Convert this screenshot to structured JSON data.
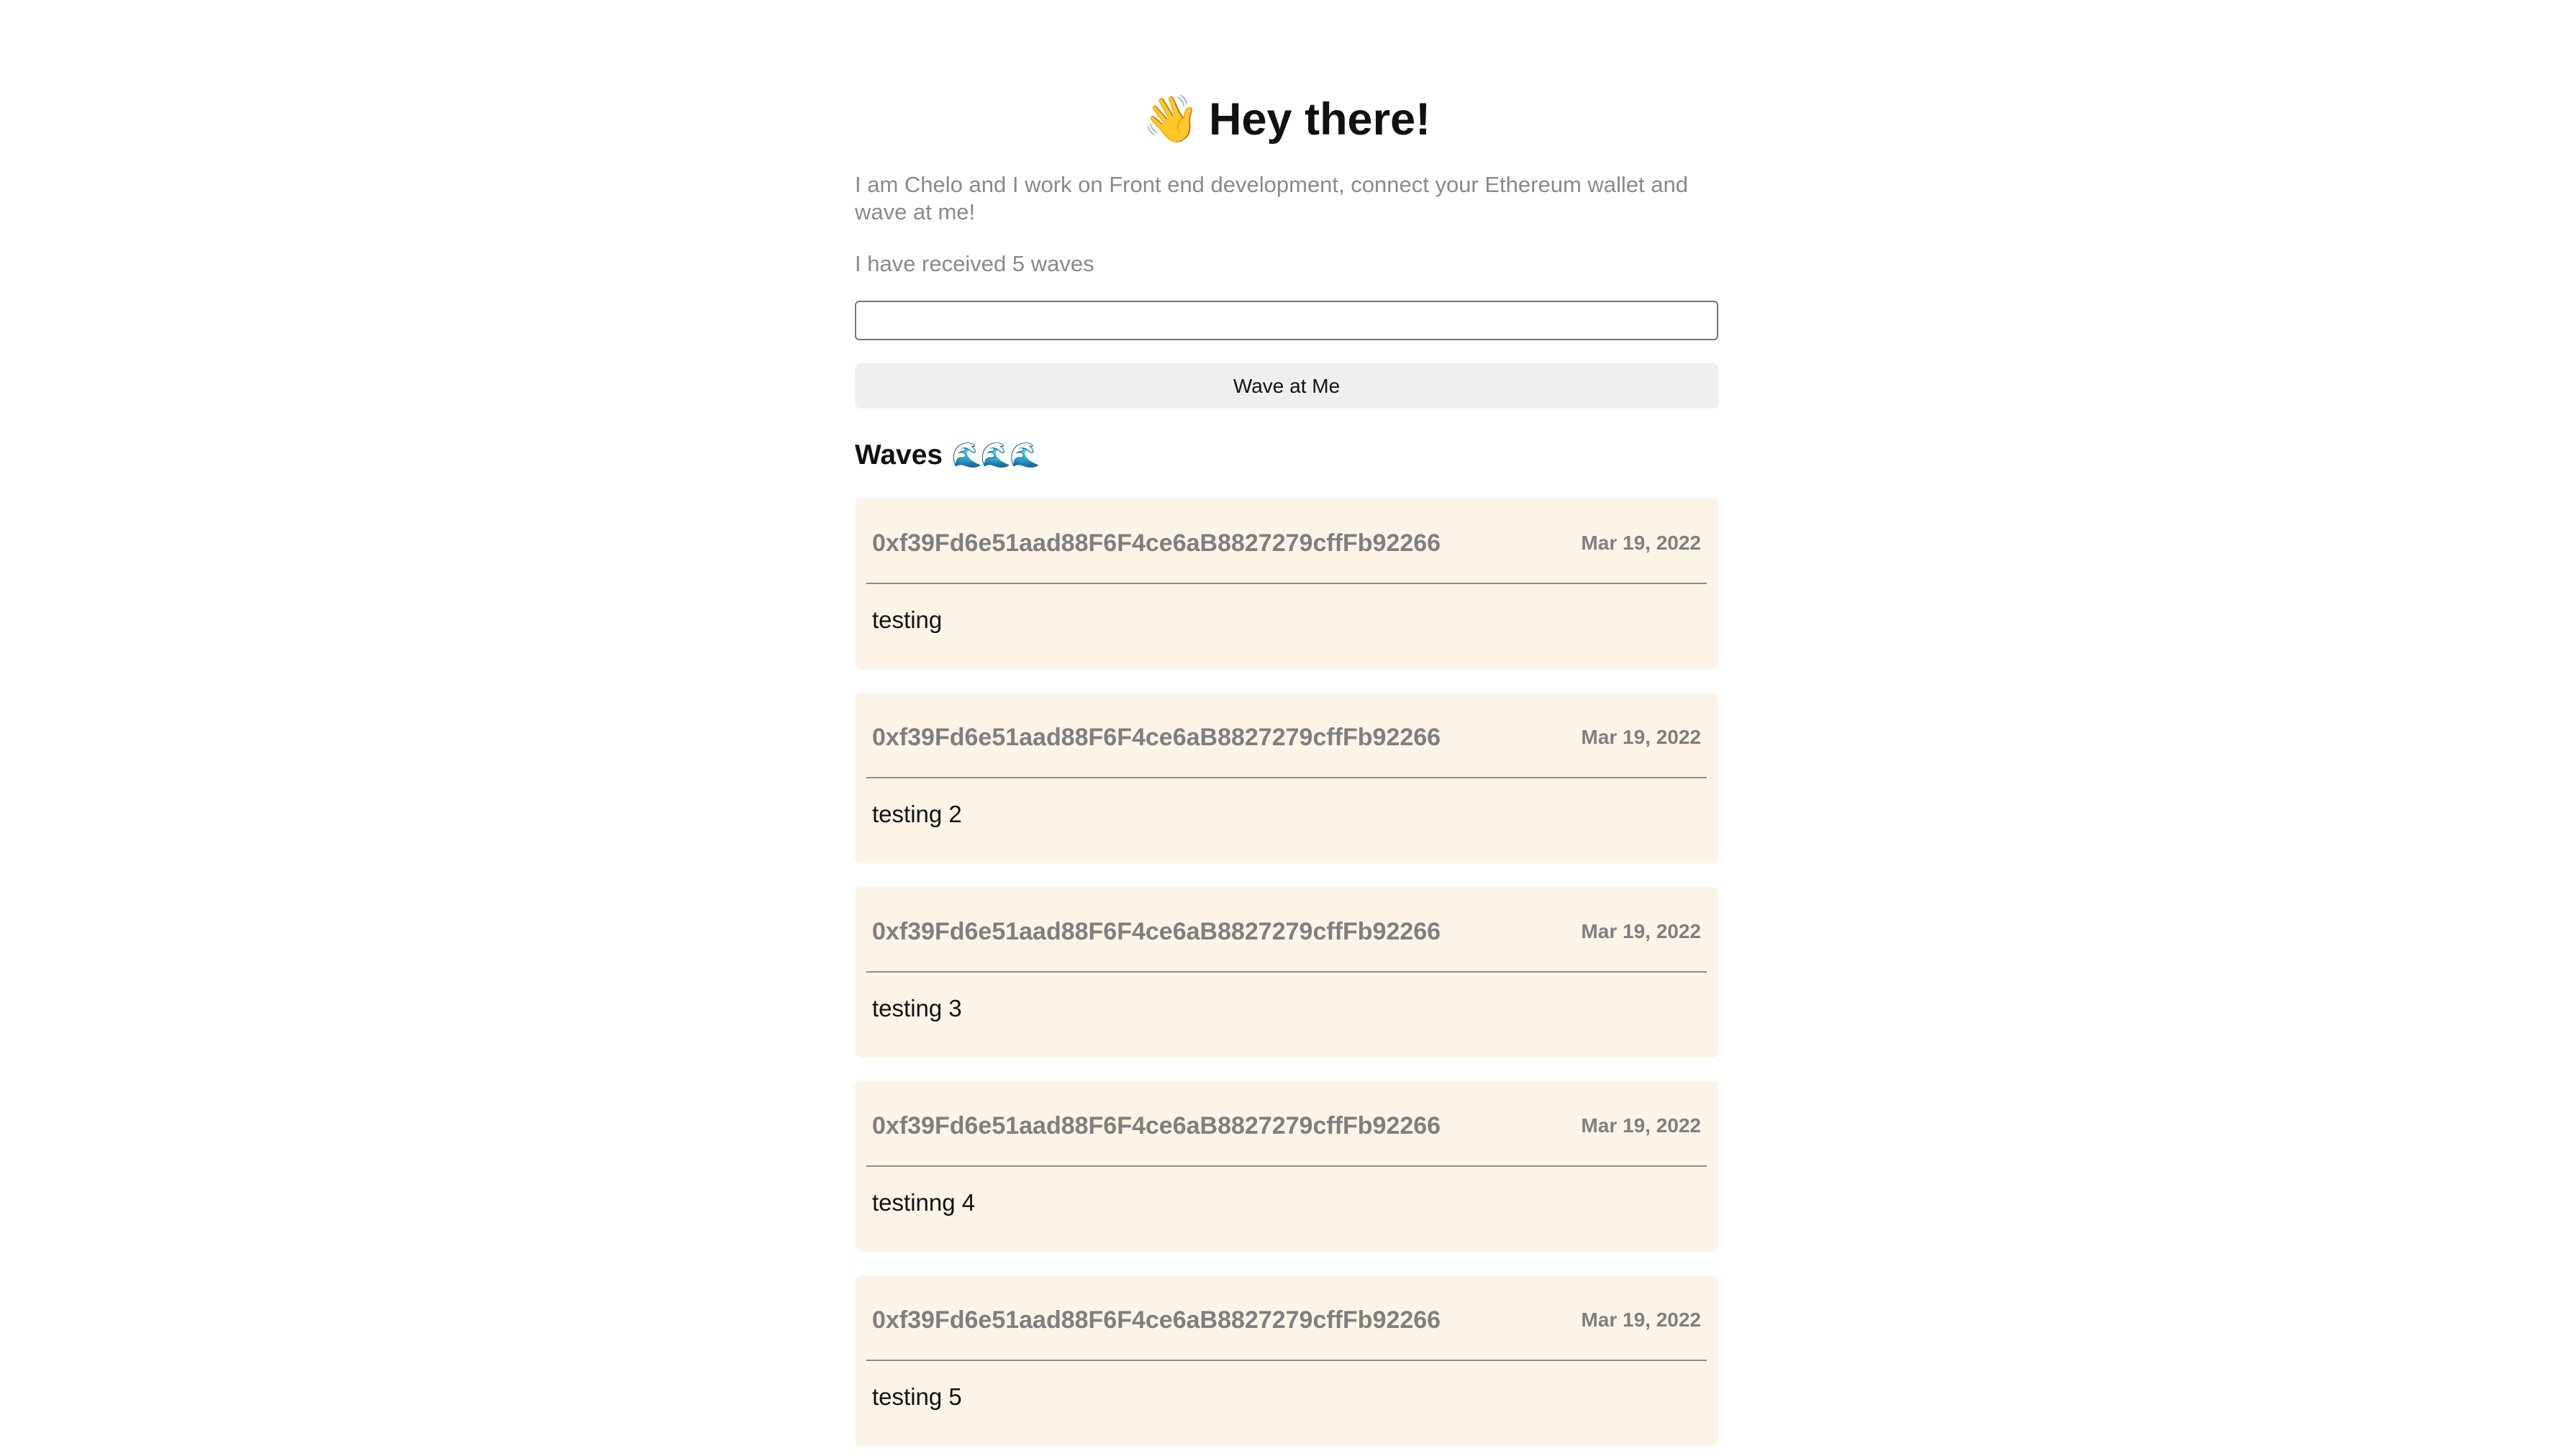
{
  "header": {
    "emoji": "👋",
    "title": "Hey there!"
  },
  "bio": "I am Chelo and I work on Front end development, connect your Ethereum wallet and wave at me!",
  "wave_count_text": "I have received 5 waves",
  "message_input": {
    "value": "",
    "placeholder": ""
  },
  "wave_button_label": "Wave at Me",
  "waves_section": {
    "title": "Waves",
    "emoji": "🌊🌊🌊"
  },
  "waves": [
    {
      "address": "0xf39Fd6e51aad88F6F4ce6aB8827279cffFb92266",
      "date": "Mar 19, 2022",
      "message": "testing"
    },
    {
      "address": "0xf39Fd6e51aad88F6F4ce6aB8827279cffFb92266",
      "date": "Mar 19, 2022",
      "message": "testing 2"
    },
    {
      "address": "0xf39Fd6e51aad88F6F4ce6aB8827279cffFb92266",
      "date": "Mar 19, 2022",
      "message": "testing 3"
    },
    {
      "address": "0xf39Fd6e51aad88F6F4ce6aB8827279cffFb92266",
      "date": "Mar 19, 2022",
      "message": "testinng 4"
    },
    {
      "address": "0xf39Fd6e51aad88F6F4ce6aB8827279cffFb92266",
      "date": "Mar 19, 2022",
      "message": "testing 5"
    }
  ],
  "colors": {
    "card_background": "#fcf4e6",
    "muted_text": "#8a8a8a",
    "button_background": "#efefef"
  }
}
